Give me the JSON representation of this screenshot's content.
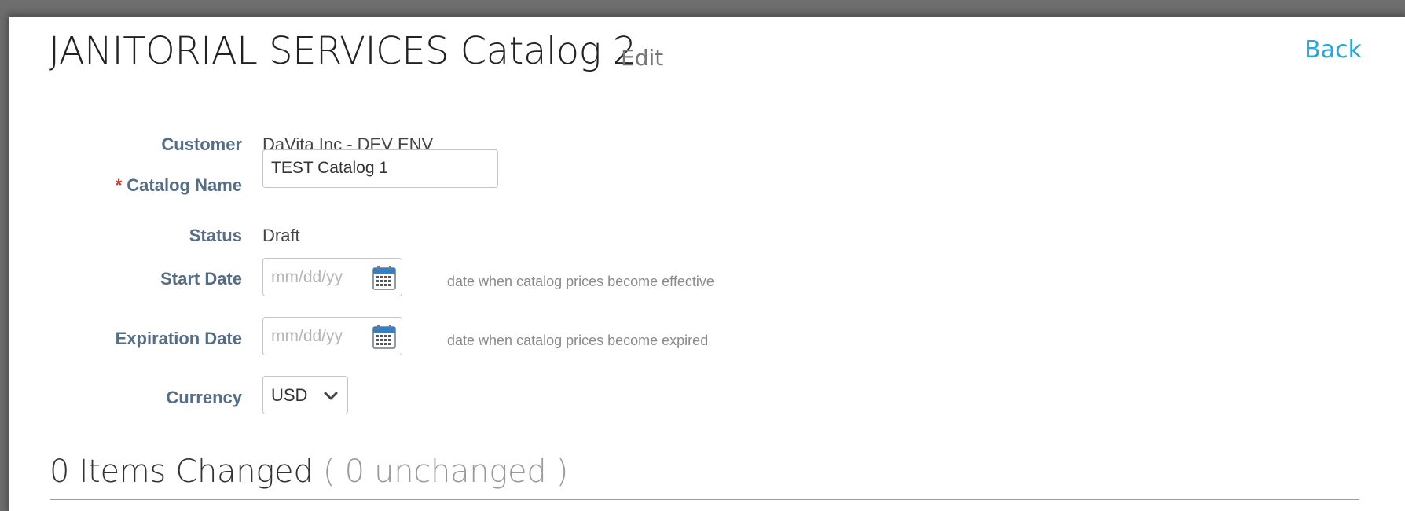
{
  "header": {
    "title": "JANITORIAL SERVICES Catalog 2",
    "edit_label": "Edit",
    "back_label": "Back"
  },
  "form": {
    "customer": {
      "label": "Customer",
      "value": "DaVita Inc - DEV ENV"
    },
    "catalog_name": {
      "required_mark": "*",
      "label": "Catalog Name",
      "value": "TEST Catalog 1"
    },
    "status": {
      "label": "Status",
      "value": "Draft"
    },
    "start_date": {
      "label": "Start Date",
      "placeholder": "mm/dd/yy",
      "hint": "date when catalog prices become effective",
      "icon": "calendar-icon"
    },
    "expiration_date": {
      "label": "Expiration Date",
      "placeholder": "mm/dd/yy",
      "hint": "date when catalog prices become expired",
      "icon": "calendar-icon"
    },
    "currency": {
      "label": "Currency",
      "value": "USD",
      "icon": "chevron-down-icon"
    }
  },
  "items_summary": {
    "changed": "0 Items Changed",
    "unchanged": "( 0 unchanged )"
  },
  "colors": {
    "accent": "#28a6dd",
    "label": "#566d86",
    "required": "#c0392b",
    "calendar_icon": "#2f80c8"
  }
}
